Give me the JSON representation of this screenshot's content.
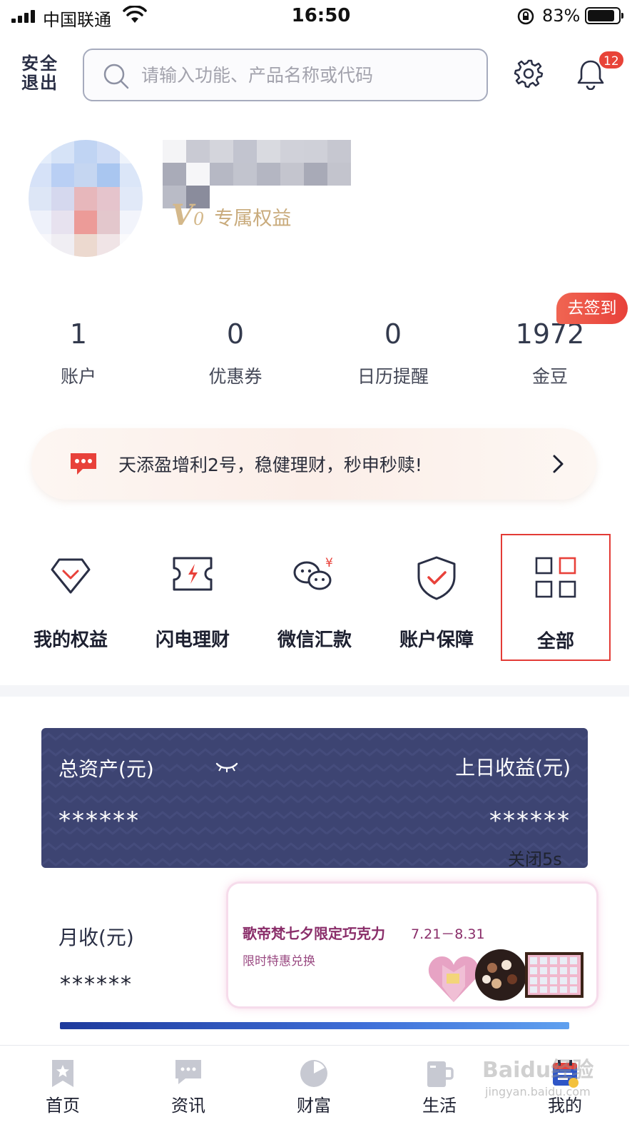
{
  "status_bar": {
    "carrier": "中国联通",
    "time": "16:50",
    "battery": "83%"
  },
  "header": {
    "logout_label": "安全退出",
    "search_placeholder": "请输入功能、产品名称或代码",
    "notification_count": "12"
  },
  "profile": {
    "vip_letter": "V",
    "vip_level": "0",
    "vip_label": "专属权益"
  },
  "stats": [
    {
      "value": "1",
      "label": "账户"
    },
    {
      "value": "0",
      "label": "优惠券"
    },
    {
      "value": "0",
      "label": "日历提醒"
    },
    {
      "value": "1972",
      "label": "金豆"
    }
  ],
  "checkin_label": "去签到",
  "promo": {
    "text": "天添盈增利2号，稳健理财，秒申秒赎!"
  },
  "quick_actions": [
    {
      "label": "我的权益",
      "icon": "diamond-icon"
    },
    {
      "label": "闪电理财",
      "icon": "lightning-ticket-icon"
    },
    {
      "label": "微信汇款",
      "icon": "wechat-yuan-icon"
    },
    {
      "label": "账户保障",
      "icon": "shield-check-icon"
    },
    {
      "label": "全部",
      "icon": "grid-icon"
    }
  ],
  "assets": {
    "total_label": "总资产(元)",
    "total_value": "******",
    "yesterday_label": "上日收益(元)",
    "yesterday_value": "******",
    "close_timer": "关闭5s"
  },
  "monthly": {
    "label": "月收(元)",
    "value": "******"
  },
  "ad": {
    "title": "歌帝梵七夕限定巧克力",
    "date": "7.21－8.31",
    "subtitle": "限时特惠兑换"
  },
  "tabs": [
    {
      "label": "首页",
      "icon": "bookmark-star-icon"
    },
    {
      "label": "资讯",
      "icon": "chat-bubble-icon"
    },
    {
      "label": "财富",
      "icon": "pie-chart-icon"
    },
    {
      "label": "生活",
      "icon": "cup-icon"
    },
    {
      "label": "我的",
      "icon": "calendar-icon"
    }
  ],
  "watermark": {
    "text": "Baidu经验",
    "sub": "jingyan.baidu.com"
  },
  "colors": {
    "accent_red": "#e8413a",
    "card_navy": "#3d4472",
    "vip_gold": "#d4b88a"
  }
}
